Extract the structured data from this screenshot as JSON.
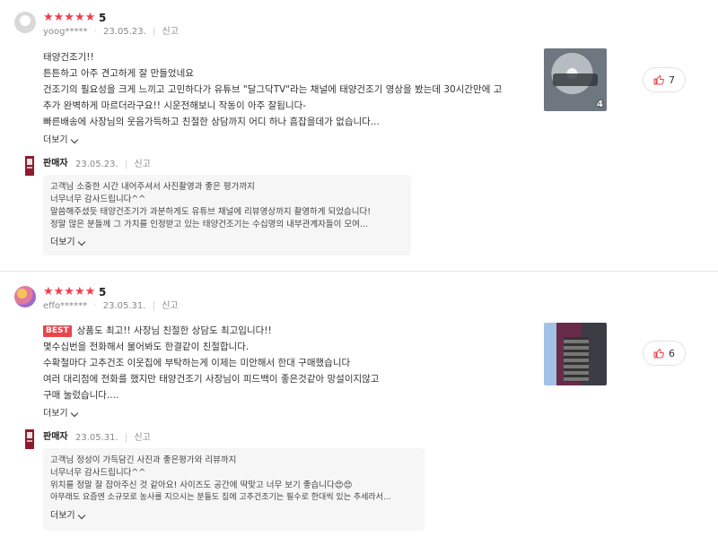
{
  "reviews": [
    {
      "stars": "★★★★★",
      "score": "5",
      "user": "yoog*****",
      "date": "23.05.23.",
      "report": "신고",
      "lines": [
        "태양건조기!!",
        "튼튼하고 아주 견고하게 잘 만들었네요",
        "건조기의 필요성을 크게 느끼고 고민하다가 유튜브 \"달그닥TV\"라는 채널에 태양건조기 영상을 봤는데 30시간만에 고",
        "추가 완벽하게 마르더라구요!! 시운전해보니 작동이 아주 잘됩니다-",
        "빠른배송에 사장님의 웃음가득하고 친절한 상담까지 어디 하나 흠잡을데가 없습니다..."
      ],
      "more": "더보기",
      "photo_count": "4",
      "likes": "7",
      "seller": {
        "name": "판매자",
        "date": "23.05.23.",
        "report": "신고",
        "lines": [
          "고객님 소중한 시간 내어주셔서 사진촬영과 좋은 평가까지",
          "너무너무 감사드립니다^^",
          "말씀해주셨듯 태양건조기가 과분하게도 유튜브 채널에 리뷰영상까지 촬영하게 되었습니다!",
          "정말 많은 분들께 그 가치를 인정받고 있는 태양건조기는 수십명의 내부관계자들이 모여..."
        ],
        "more": "더보기"
      }
    },
    {
      "stars": "★★★★★",
      "score": "5",
      "user": "effo******",
      "date": "23.05.31.",
      "report": "신고",
      "badge": "BEST",
      "lines": [
        "상품도 최고!! 사장님 친절한 상담도 최고입니다!!",
        "몇수십번을 전화해서 물어봐도 한결같이 친절합니다.",
        "수확철마다 고추건조 이웃집에 부탁하는게 이제는 미안해서 한대 구매했습니다",
        "여러 대리점에 전화를 했지만 태양건조기 사장님이 피드백이 좋은것같아 망설이지않고",
        "구매 눌렀습니다...."
      ],
      "more": "더보기",
      "likes": "6",
      "seller": {
        "name": "판매자",
        "date": "23.05.31.",
        "report": "신고",
        "lines": [
          "고객님 정성이 가득담긴 사진과 좋은평가와 리뷰까지",
          "너무너무 감사드립니다^^",
          "위치를 정말 잘 잡아주신 것 같아요! 사이즈도 공간에 딱맞고 너무 보기 좋습니다😍😍",
          "아무래도 요즘엔 소규모로 농사를 지으시는 분들도 집에 고추건조기는 필수로 한대씩 있는 추세라서..."
        ],
        "more": "더보기"
      }
    }
  ],
  "icons": {
    "like": "thumb-up-icon",
    "chevron": "chevron-down-icon"
  },
  "colors": {
    "star": "#f23d4f",
    "best_badge": "#e8454c",
    "like_icon": "#e8454c"
  }
}
